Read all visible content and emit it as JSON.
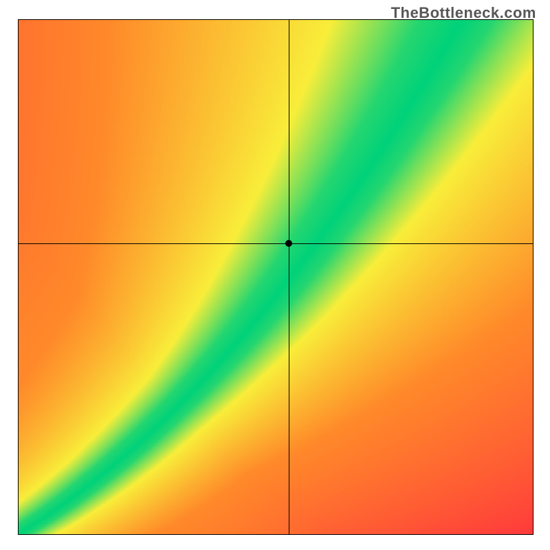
{
  "watermark": "TheBottleneck.com",
  "chart_data": {
    "type": "heatmap",
    "title": "",
    "xlabel": "",
    "ylabel": "",
    "xlim": [
      0,
      1
    ],
    "ylim": [
      0,
      1
    ],
    "marker": {
      "x": 0.525,
      "y": 0.565
    },
    "crosshair": {
      "x": 0.525,
      "y": 0.565
    },
    "ideal_curve_samples": [
      {
        "x": 0.0,
        "y": 0.0
      },
      {
        "x": 0.05,
        "y": 0.06
      },
      {
        "x": 0.1,
        "y": 0.11
      },
      {
        "x": 0.15,
        "y": 0.15
      },
      {
        "x": 0.2,
        "y": 0.19
      },
      {
        "x": 0.25,
        "y": 0.24
      },
      {
        "x": 0.3,
        "y": 0.29
      },
      {
        "x": 0.35,
        "y": 0.35
      },
      {
        "x": 0.4,
        "y": 0.41
      },
      {
        "x": 0.45,
        "y": 0.47
      },
      {
        "x": 0.5,
        "y": 0.54
      },
      {
        "x": 0.55,
        "y": 0.6
      },
      {
        "x": 0.6,
        "y": 0.66
      },
      {
        "x": 0.65,
        "y": 0.73
      },
      {
        "x": 0.7,
        "y": 0.79
      },
      {
        "x": 0.75,
        "y": 0.85
      },
      {
        "x": 0.8,
        "y": 0.92
      },
      {
        "x": 0.85,
        "y": 0.98
      },
      {
        "x": 0.9,
        "y": 1.04
      },
      {
        "x": 0.95,
        "y": 1.1
      }
    ],
    "colors": {
      "optimal": "#00d27a",
      "near": "#f9ee3a",
      "mid": "#ff8a2a",
      "far": "#ff1744"
    },
    "note": "Heatmap diagonal optimum band; green along slightly superlinear curve through origin; marker sits on band upper edge."
  }
}
